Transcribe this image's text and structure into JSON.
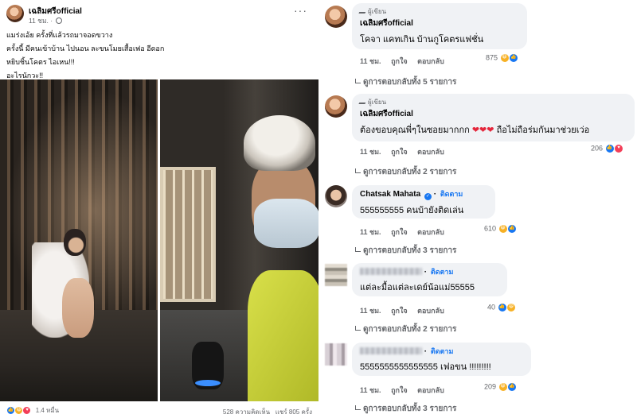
{
  "post": {
    "author": "เฉลิมศรีofficial",
    "time": "11 ชม.",
    "lines": [
      "แมร่งเอ้ย ครั้งที่แล้วรถมาจอดขวาง",
      "ครั้งนี้ มีคนเข้าบ้าน ไปนอน ละขนโมยเสื้อเฟอ อีดอก",
      "หยิบชิ้นโคตร ไอเหน!!!",
      "อะไรนักวะ!!"
    ],
    "reaction_count": "1.4 หมื่น",
    "comment_count": "528 ความคิดเห็น",
    "share_count": "แชร์ 805 ครั้ง"
  },
  "comments": [
    {
      "badge": "ผู้เขียน",
      "name": "เฉลิมศรีofficial",
      "text": "โคจา แคทเกิน บ้านกูโคตรแฟชั่น",
      "time": "11 ชม.",
      "like": "ถูกใจ",
      "reply": "ตอบกลับ",
      "reactions": "875",
      "replies": "ดูการตอบกลับทั้ง 5 รายการ"
    },
    {
      "badge": "ผู้เขียน",
      "name": "เฉลิมศรีofficial",
      "text": "ต้องขอบคุณพี่ๆในซอยมากกก",
      "text_tail": "ถือไม่ถือร่มกันมาช่วยเว่อ",
      "time": "11 ชม.",
      "like": "ถูกใจ",
      "reply": "ตอบกลับ",
      "reactions": "206",
      "replies": "ดูการตอบกลับทั้ง 2 รายการ"
    },
    {
      "name": "Chatsak Mahata",
      "follow": "ติดตาม",
      "text": "555555555 คนบ้ายังติดเล่น",
      "time": "11 ชม.",
      "like": "ถูกใจ",
      "reply": "ตอบกลับ",
      "reactions": "610",
      "replies": "ดูการตอบกลับทั้ง 3 รายการ"
    },
    {
      "follow": "ติดตาม",
      "text": "แต่ละมื้อแต่ละเดย์น้อแม่55555",
      "time": "11 ชม.",
      "like": "ถูกใจ",
      "reply": "ตอบกลับ",
      "reactions": "40",
      "replies": "ดูการตอบกลับทั้ง 2 รายการ"
    },
    {
      "follow": "ติดตาม",
      "text": "5555555555555555 เฟอขน !!!!!!!!!",
      "time": "11 ชม.",
      "like": "ถูกใจ",
      "reply": "ตอบกลับ",
      "reactions": "209",
      "replies": "ดูการตอบกลับทั้ง 3 รายการ"
    }
  ],
  "colors": {
    "link_blue": "#1877f2",
    "bubble_gray": "#f0f2f5",
    "meta_gray": "#65676b"
  }
}
